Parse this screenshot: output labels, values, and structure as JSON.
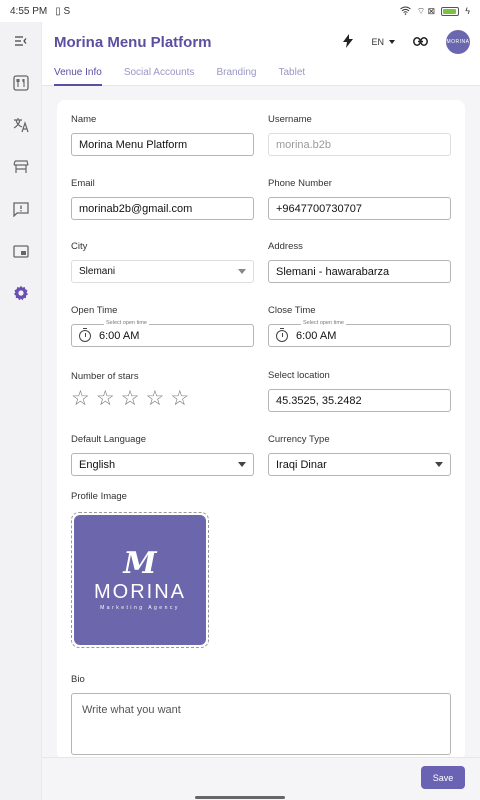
{
  "status_bar": {
    "time": "4:55 PM",
    "left_icons": "▯ S",
    "right_icons": "⌔ ⊠",
    "battery": "85"
  },
  "app": {
    "title": "Morina Menu Platform",
    "language": "EN",
    "avatar_text": "MORINA"
  },
  "colors": {
    "accent": "#5b4fa0",
    "button": "#6a63b4",
    "profile_bg": "#6c66ad"
  },
  "tabs": [
    {
      "label": "Venue Info",
      "active": true
    },
    {
      "label": "Social Accounts",
      "active": false
    },
    {
      "label": "Branding",
      "active": false
    },
    {
      "label": "Tablet",
      "active": false
    }
  ],
  "form": {
    "name": {
      "label": "Name",
      "value": "Morina Menu Platform"
    },
    "username": {
      "label": "Username",
      "value": "morina.b2b"
    },
    "email": {
      "label": "Email",
      "value": "morinab2b@gmail.com"
    },
    "phone": {
      "label": "Phone Number",
      "value": "+9647700730707"
    },
    "city": {
      "label": "City",
      "value": "Slemani"
    },
    "address": {
      "label": "Address",
      "value": "Slemani - hawarabarza"
    },
    "open_time": {
      "label": "Open Time",
      "float": "Select open time",
      "value": "6:00 AM"
    },
    "close_time": {
      "label": "Close Time",
      "float": "Select open time",
      "value": "6:00 AM"
    },
    "stars": {
      "label": "Number of stars",
      "count": 5,
      "selected": 0
    },
    "location": {
      "label": "Select location",
      "value": "45.3525, 35.2482"
    },
    "language": {
      "label": "Default Language",
      "value": "English"
    },
    "currency": {
      "label": "Currency Type",
      "value": "Iraqi Dinar"
    },
    "profile": {
      "label": "Profile Image",
      "logo_mark": "M",
      "logo_text": "MORINA",
      "logo_sub": "Marketing Agency"
    },
    "bio": {
      "label": "Bio",
      "placeholder": "Write what you want"
    }
  },
  "footer": {
    "save_label": "Save"
  },
  "icons": [
    "menu-collapse-icon",
    "restaurant-icon",
    "translate-icon",
    "store-icon",
    "feedback-icon",
    "tablet-icon",
    "settings-icon",
    "flash-icon",
    "chevron-down-icon",
    "link-icon",
    "clock-icon",
    "star-icon",
    "caret-down-icon"
  ]
}
